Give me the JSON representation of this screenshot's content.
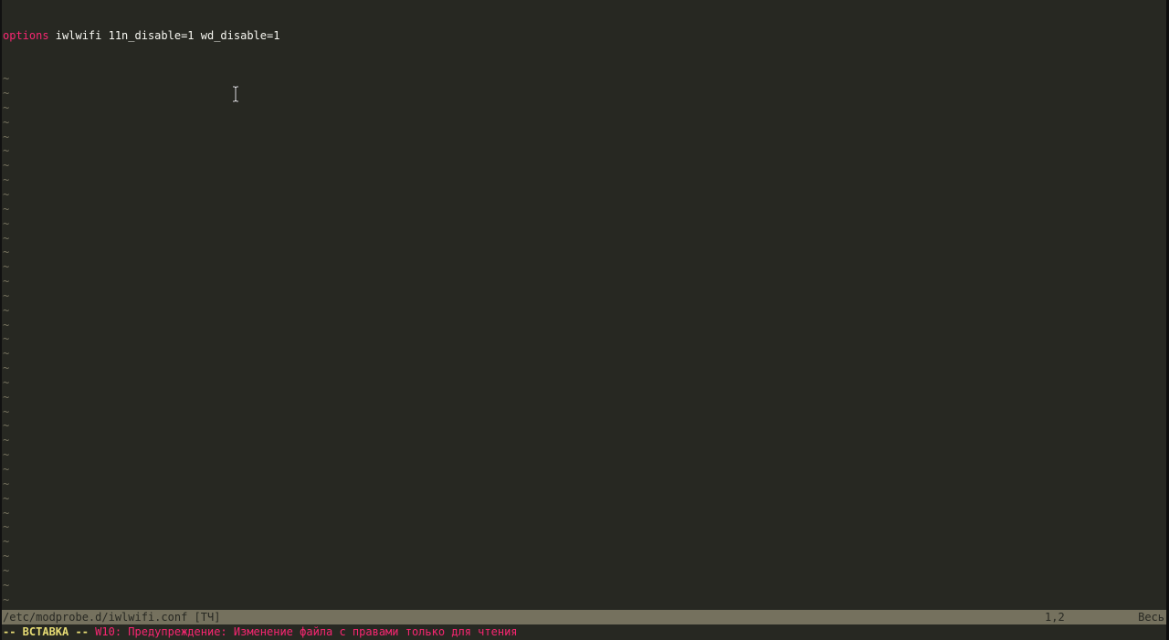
{
  "editor": {
    "first_line": {
      "keyword": "options",
      "rest": " iwlwifi 11n_disable=1 wd_disable=1"
    },
    "empty_line_marker": "~",
    "empty_line_count": 41
  },
  "statusline": {
    "filename": "/etc/modprobe.d/iwlwifi.conf [ТЧ]",
    "position": "1,2",
    "scroll": "Весь"
  },
  "cmdline": {
    "mode": "-- ВСТАВКА --",
    "warning": "W10: Предупреждение: Изменение файла с правами только для чтения"
  },
  "colors": {
    "background": "#272822",
    "keyword": "#f92672",
    "text": "#f8f8f2",
    "tilde": "#75715e",
    "statusline_bg": "#75715e",
    "mode": "#e6db74",
    "warning": "#f92672"
  },
  "icons": {
    "mouse_cursor": "text-ibeam-cursor-icon"
  }
}
